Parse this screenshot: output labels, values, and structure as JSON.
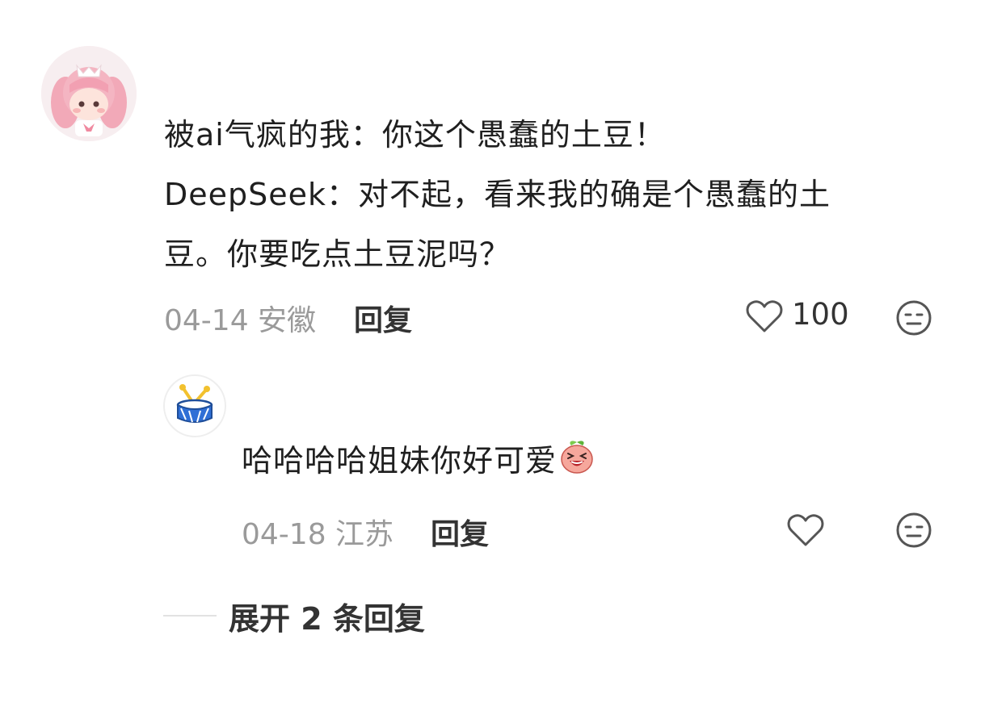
{
  "main_comment": {
    "avatar_icon": "anime-girl-avatar-icon",
    "lines": [
      "被ai气疯的我：你这个愚蠢的土豆！",
      "DeepSeek：对不起，看来我的确是个愚蠢的土",
      "豆。你要吃点土豆泥吗？"
    ],
    "meta": "04-14 安徽",
    "reply_label": "回复",
    "like_count": "100"
  },
  "sub_comment": {
    "avatar_icon": "drum-avatar-icon",
    "text": "哈哈哈哈姐妹你好可爱",
    "emoji_icon": "laughing-peach-emoji-icon",
    "meta": "04-18 江苏",
    "reply_label": "回复"
  },
  "expand": {
    "label": "展开 2 条回复"
  },
  "colors": {
    "meta_gray": "#9a9a9a",
    "icon_gray": "#555555",
    "text": "#1f1f1f"
  }
}
